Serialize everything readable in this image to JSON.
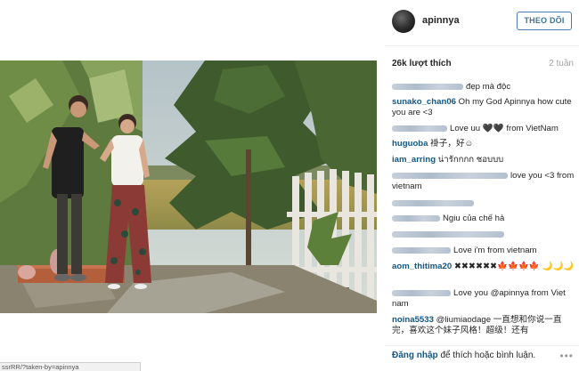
{
  "header": {
    "username": "apinnya",
    "follow_label": "THEO DÕI"
  },
  "meta": {
    "likes": "26k lượt thích",
    "time": "2 tuần"
  },
  "comments": [
    {
      "user": "",
      "text": "đẹp mà độc"
    },
    {
      "user": "sunako_chan06",
      "text": "Oh my God Apinnya how cute you are <3"
    },
    {
      "user": "",
      "text": "Love uu 🖤🖤 from VietNam"
    },
    {
      "user": "huguoba",
      "text": "褂子，好☺"
    },
    {
      "user": "iam_arring",
      "text": "น่ารักกกก ชอบบบ"
    },
    {
      "user": "",
      "text": "love you <3 from vietnam"
    },
    {
      "user": "",
      "text": ""
    },
    {
      "user": "",
      "text": "Ngiu của chế hả"
    },
    {
      "user": "",
      "text": ""
    },
    {
      "user": "",
      "text": "Love i'm from vietnam"
    },
    {
      "user": "aom_thitima20",
      "text": "✖✖✖✖✖✖🍁🍁🍁🍁 🌙🌙🌙"
    },
    {
      "user": "",
      "text": "Love you @apinnya from Viet nam"
    },
    {
      "user": "noina5533",
      "text": "@liumiaodage 一直想和你说一直完，喜欢这个妹子风格！超级！还有"
    }
  ],
  "footer": {
    "login_label": "Đăng nhập",
    "rest_label": " để thích hoặc bình luận.",
    "more_label": "•••"
  },
  "statusbar": {
    "url": "ssrRR/?taken-by=apinnya"
  }
}
